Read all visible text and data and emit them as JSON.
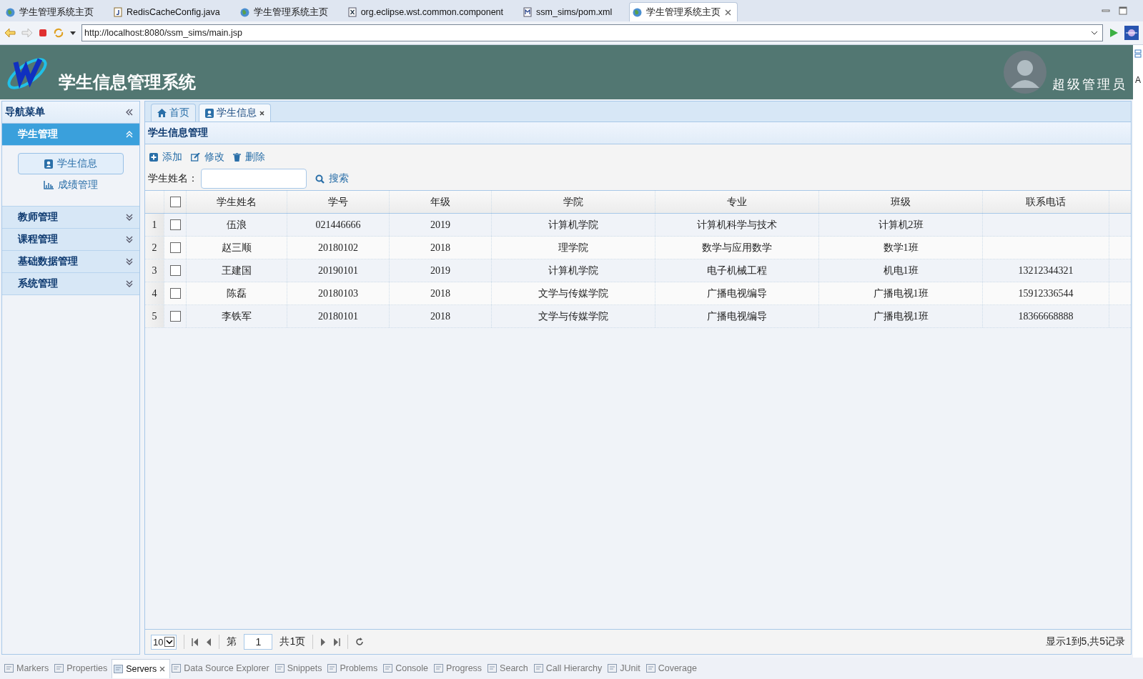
{
  "browser_tabs": [
    {
      "label": "学生管理系统主页",
      "kind": "globe",
      "selected": false
    },
    {
      "label": "RedisCacheConfig.java",
      "kind": "java",
      "selected": false
    },
    {
      "label": "学生管理系统主页",
      "kind": "globe",
      "selected": false
    },
    {
      "label": "org.eclipse.wst.common.component",
      "kind": "xml",
      "selected": false
    },
    {
      "label": "ssm_sims/pom.xml",
      "kind": "maven",
      "selected": false
    },
    {
      "label": "学生管理系统主页",
      "kind": "globe",
      "selected": true
    }
  ],
  "url": "http://localhost:8080/ssm_sims/main.jsp",
  "side_letter": "A",
  "header": {
    "title": "学生信息管理系统",
    "user": "超级管理员"
  },
  "nav": {
    "title": "导航菜单",
    "groups": [
      {
        "label": "学生管理",
        "expanded": true,
        "items": [
          {
            "label": "学生信息",
            "kind": "card",
            "selected": true
          },
          {
            "label": "成绩管理",
            "kind": "chart",
            "selected": false
          }
        ]
      },
      {
        "label": "教师管理",
        "expanded": false
      },
      {
        "label": "课程管理",
        "expanded": false
      },
      {
        "label": "基础数据管理",
        "expanded": false
      },
      {
        "label": "系统管理",
        "expanded": false
      }
    ]
  },
  "content_tabs": [
    {
      "label": "首页",
      "kind": "home",
      "selected": false,
      "closable": false
    },
    {
      "label": "学生信息",
      "kind": "card",
      "selected": true,
      "closable": true
    }
  ],
  "panel_title": "学生信息管理",
  "toolbar": [
    {
      "label": "添加",
      "kind": "add"
    },
    {
      "label": "修改",
      "kind": "edit"
    },
    {
      "label": "删除",
      "kind": "delete"
    }
  ],
  "search": {
    "label": "学生姓名：",
    "button": "搜索"
  },
  "table": {
    "header_checked": false,
    "columns": [
      "学生姓名",
      "学号",
      "年级",
      "学院",
      "专业",
      "班级",
      "联系电话"
    ],
    "rows": [
      {
        "index": "1",
        "checked": false,
        "cells": [
          "伍浪",
          "021446666",
          "2019",
          "计算机学院",
          "计算机科学与技术",
          "计算机2班",
          ""
        ]
      },
      {
        "index": "2",
        "checked": false,
        "cells": [
          "赵三顺",
          "20180102",
          "2018",
          "理学院",
          "数学与应用数学",
          "数学1班",
          ""
        ]
      },
      {
        "index": "3",
        "checked": false,
        "cells": [
          "王建国",
          "20190101",
          "2019",
          "计算机学院",
          "电子机械工程",
          "机电1班",
          "13212344321"
        ]
      },
      {
        "index": "4",
        "checked": false,
        "cells": [
          "陈磊",
          "20180103",
          "2018",
          "文学与传媒学院",
          "广播电视编导",
          "广播电视1班",
          "15912336544"
        ]
      },
      {
        "index": "5",
        "checked": false,
        "cells": [
          "李铁军",
          "20180101",
          "2018",
          "文学与传媒学院",
          "广播电视编导",
          "广播电视1班",
          "18366668888"
        ]
      }
    ]
  },
  "pagination": {
    "page_size": "10",
    "before": "第",
    "page": "1",
    "after": "共1页",
    "summary": "显示1到5,共5记录"
  },
  "bottom_tabs": [
    {
      "label": "Markers",
      "selected": false
    },
    {
      "label": "Properties",
      "selected": false
    },
    {
      "label": "Servers",
      "selected": true
    },
    {
      "label": "Data Source Explorer",
      "selected": false
    },
    {
      "label": "Snippets",
      "selected": false
    },
    {
      "label": "Problems",
      "selected": false
    },
    {
      "label": "Console",
      "selected": false
    },
    {
      "label": "Progress",
      "selected": false
    },
    {
      "label": "Search",
      "selected": false
    },
    {
      "label": "Call Hierarchy",
      "selected": false
    },
    {
      "label": "JUnit",
      "selected": false
    },
    {
      "label": "Coverage",
      "selected": false
    }
  ]
}
